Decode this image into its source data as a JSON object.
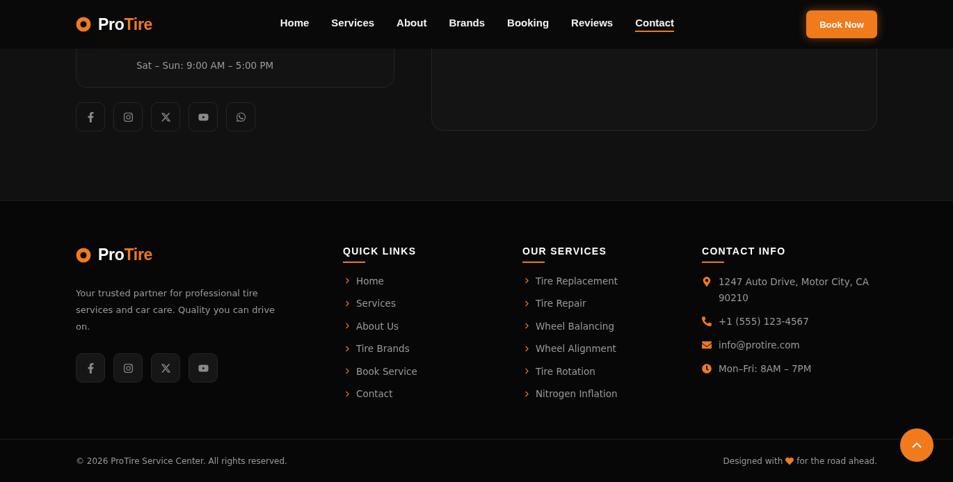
{
  "header": {
    "logo": {
      "first": "Pro",
      "second": "Tire"
    },
    "nav": [
      {
        "label": "Home",
        "selected": false
      },
      {
        "label": "Services",
        "selected": false
      },
      {
        "label": "About",
        "selected": false
      },
      {
        "label": "Brands",
        "selected": false
      },
      {
        "label": "Booking",
        "selected": false
      },
      {
        "label": "Reviews",
        "selected": false
      },
      {
        "label": "Contact",
        "selected": true
      }
    ],
    "cta": "Book Now"
  },
  "hours_card": {
    "lines": [
      "Sat – Sun: 9:00 AM – 5:00 PM"
    ]
  },
  "contact_socials": [
    {
      "kind": "facebook"
    },
    {
      "kind": "instagram"
    },
    {
      "kind": "x"
    },
    {
      "kind": "youtube"
    },
    {
      "kind": "whatsapp"
    }
  ],
  "footer": {
    "logo": {
      "first": "Pro",
      "second": "Tire"
    },
    "about": "Your trusted partner for professional tire services and car care. Quality you can drive on.",
    "socials": [
      {
        "kind": "facebook"
      },
      {
        "kind": "instagram"
      },
      {
        "kind": "x"
      },
      {
        "kind": "youtube"
      }
    ],
    "quick_links": {
      "title": "QUICK LINKS",
      "items": [
        "Home",
        "Services",
        "About Us",
        "Tire Brands",
        "Book Service",
        "Contact"
      ]
    },
    "services": {
      "title": "OUR SERVICES",
      "items": [
        "Tire Replacement",
        "Tire Repair",
        "Wheel Balancing",
        "Wheel Alignment",
        "Tire Rotation",
        "Nitrogen Inflation"
      ]
    },
    "contact": {
      "title": "CONTACT INFO",
      "items": [
        {
          "kind": "address",
          "text": "1247 Auto Drive, Motor City, CA 90210"
        },
        {
          "kind": "phone",
          "text": "+1 (555) 123-4567"
        },
        {
          "kind": "email",
          "text": "info@protire.com"
        },
        {
          "kind": "hours",
          "text": "Mon–Fri: 8AM – 7PM"
        }
      ]
    },
    "copyright": "© 2026 ProTire Service Center. All rights reserved.",
    "credit": {
      "before": "Designed with",
      "after": "for the road ahead."
    }
  }
}
